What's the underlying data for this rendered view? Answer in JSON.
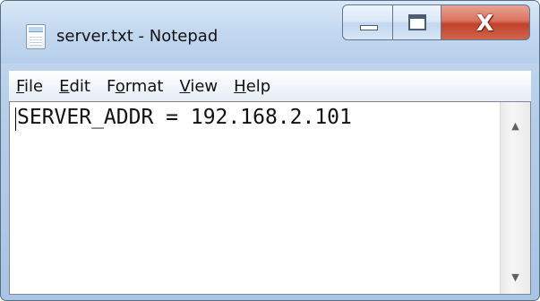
{
  "window": {
    "title": "server.txt - Notepad",
    "caption_buttons": {
      "minimize_icon": "minimize-icon",
      "maximize_icon": "maximize-icon",
      "close_glyph": "X"
    }
  },
  "menu": {
    "items": [
      {
        "label_u": "F",
        "label_rest": "ile"
      },
      {
        "label_u": "E",
        "label_rest": "dit"
      },
      {
        "label_pre": "F",
        "label_u": "o",
        "label_rest": "rmat"
      },
      {
        "label_u": "V",
        "label_rest": "iew"
      },
      {
        "label_u": "H",
        "label_rest": "elp"
      }
    ]
  },
  "editor": {
    "content": "SERVER_ADDR = 192.168.2.101"
  },
  "scrollbar": {
    "up_icon": "▲",
    "down_icon": "▼"
  },
  "colors": {
    "close_button": "#c8462f",
    "frame": "#b9d0ea"
  }
}
